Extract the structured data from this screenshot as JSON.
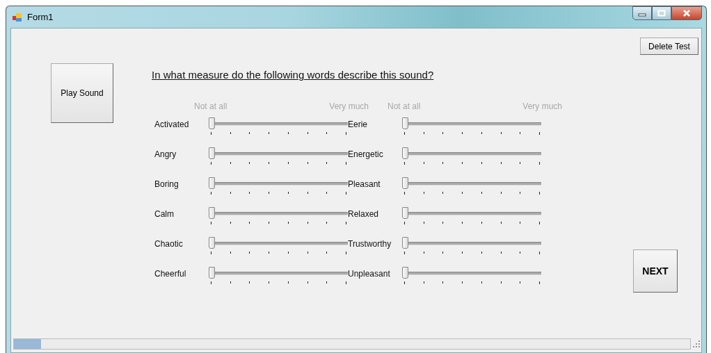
{
  "window": {
    "title": "Form1"
  },
  "play_button": "Play Sound",
  "delete_button": "Delete Test",
  "question": "In what measure do the following words describe this sound?",
  "scale_headers": [
    {
      "low": "Not at all",
      "high": "Very much"
    },
    {
      "low": "Not at all",
      "high": "Very much"
    }
  ],
  "sliders": [
    {
      "label": "Activated",
      "level": 0
    },
    {
      "label": "Eerie",
      "level": 0
    },
    {
      "label": "Angry",
      "level": 0
    },
    {
      "label": "Energetic",
      "level": 0
    },
    {
      "label": "Boring",
      "level": 0
    },
    {
      "label": "Pleasant",
      "level": 0
    },
    {
      "label": "Calm",
      "level": 0
    },
    {
      "label": "Relaxed",
      "level": 0
    },
    {
      "label": "Chaotic",
      "level": 0
    },
    {
      "label": "Trustworthy",
      "level": 0
    },
    {
      "label": "Cheerful",
      "level": 0
    },
    {
      "label": "Unpleasant",
      "level": 0
    }
  ],
  "next_button": "NEXT",
  "progress": {
    "level": 0.04
  }
}
